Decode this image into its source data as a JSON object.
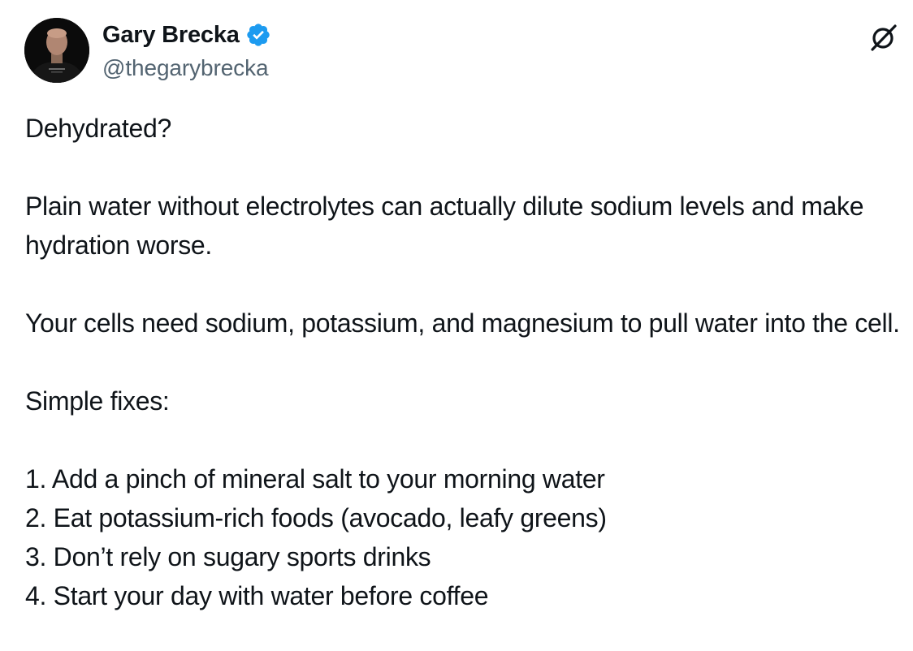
{
  "author": {
    "display_name": "Gary Brecka",
    "handle": "@thegarybrecka",
    "verified": true,
    "verified_color": "#1d9bf0"
  },
  "icons": {
    "avatar": "profile-photo",
    "verified": "verified-badge-icon",
    "logo": "grok-logo-icon"
  },
  "tweet": {
    "paragraphs": [
      "Dehydrated?",
      "Plain water without electrolytes can actually dilute sodium levels and make hydration worse.",
      "Your cells need sodium, potassium, and magnesium to pull water into the cell.",
      "Simple fixes:"
    ],
    "list": [
      "1. Add a pinch of mineral salt to your morning water",
      "2. Eat potassium-rich foods (avocado, leafy greens)",
      "3. Don’t rely on sugary sports drinks",
      "4. Start your day with water before coffee"
    ]
  },
  "colors": {
    "text": "#0f1419",
    "secondary_text": "#536471",
    "background": "#ffffff"
  }
}
